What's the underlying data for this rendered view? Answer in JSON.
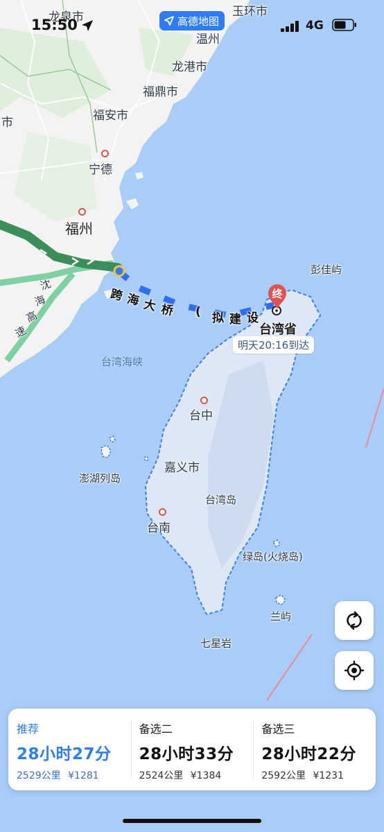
{
  "status_bar": {
    "time": "15:50",
    "network": "4G",
    "app_badge": "高德地图"
  },
  "map": {
    "place_labels": {
      "longquan": "龙泉市",
      "yuhuan": "玉环市",
      "wenzhou": "温州",
      "longgang": "龙港市",
      "fuding": "福鼎市",
      "fuan": "福安市",
      "shi_edge": "市",
      "ningde": "宁德",
      "fuzhou": "福州",
      "taiwan_strait": "台湾海峡",
      "pengjia": "彭佳屿",
      "taichung": "台中",
      "chiayi": "嘉义市",
      "penghu": "澎湖列岛",
      "taiwan_island": "台湾岛",
      "tainan": "台南",
      "green_island": "绿岛(火烧岛)",
      "orchid_island": "兰屿",
      "qixing": "七星岩"
    },
    "route_text": {
      "bridge": [
        "跨",
        "海",
        "大",
        "桥",
        "(",
        "拟",
        "建",
        "设"
      ],
      "expressway": [
        "沈",
        "海",
        "高",
        "速"
      ]
    },
    "destination": {
      "pin": "终",
      "name": "台湾省",
      "arrival": "明天20:16到达"
    }
  },
  "controls": {
    "refresh_icon": "refresh-icon",
    "locate_icon": "locate-icon"
  },
  "routes": [
    {
      "tag": "推荐",
      "duration": "28小时27分",
      "distance": "2529公里",
      "cost": "¥1281",
      "active": true
    },
    {
      "tag": "备选二",
      "duration": "28小时33分",
      "distance": "2524公里",
      "cost": "¥1384",
      "active": false
    },
    {
      "tag": "备选三",
      "duration": "28小时22分",
      "distance": "2592公里",
      "cost": "¥1231",
      "active": false
    }
  ],
  "colors": {
    "sea": "#a9cdf7",
    "land": "#f3f4f1",
    "route": "#2f7cf6",
    "route_alt": "#3b8d5a",
    "accent": "#2f7cf6"
  }
}
